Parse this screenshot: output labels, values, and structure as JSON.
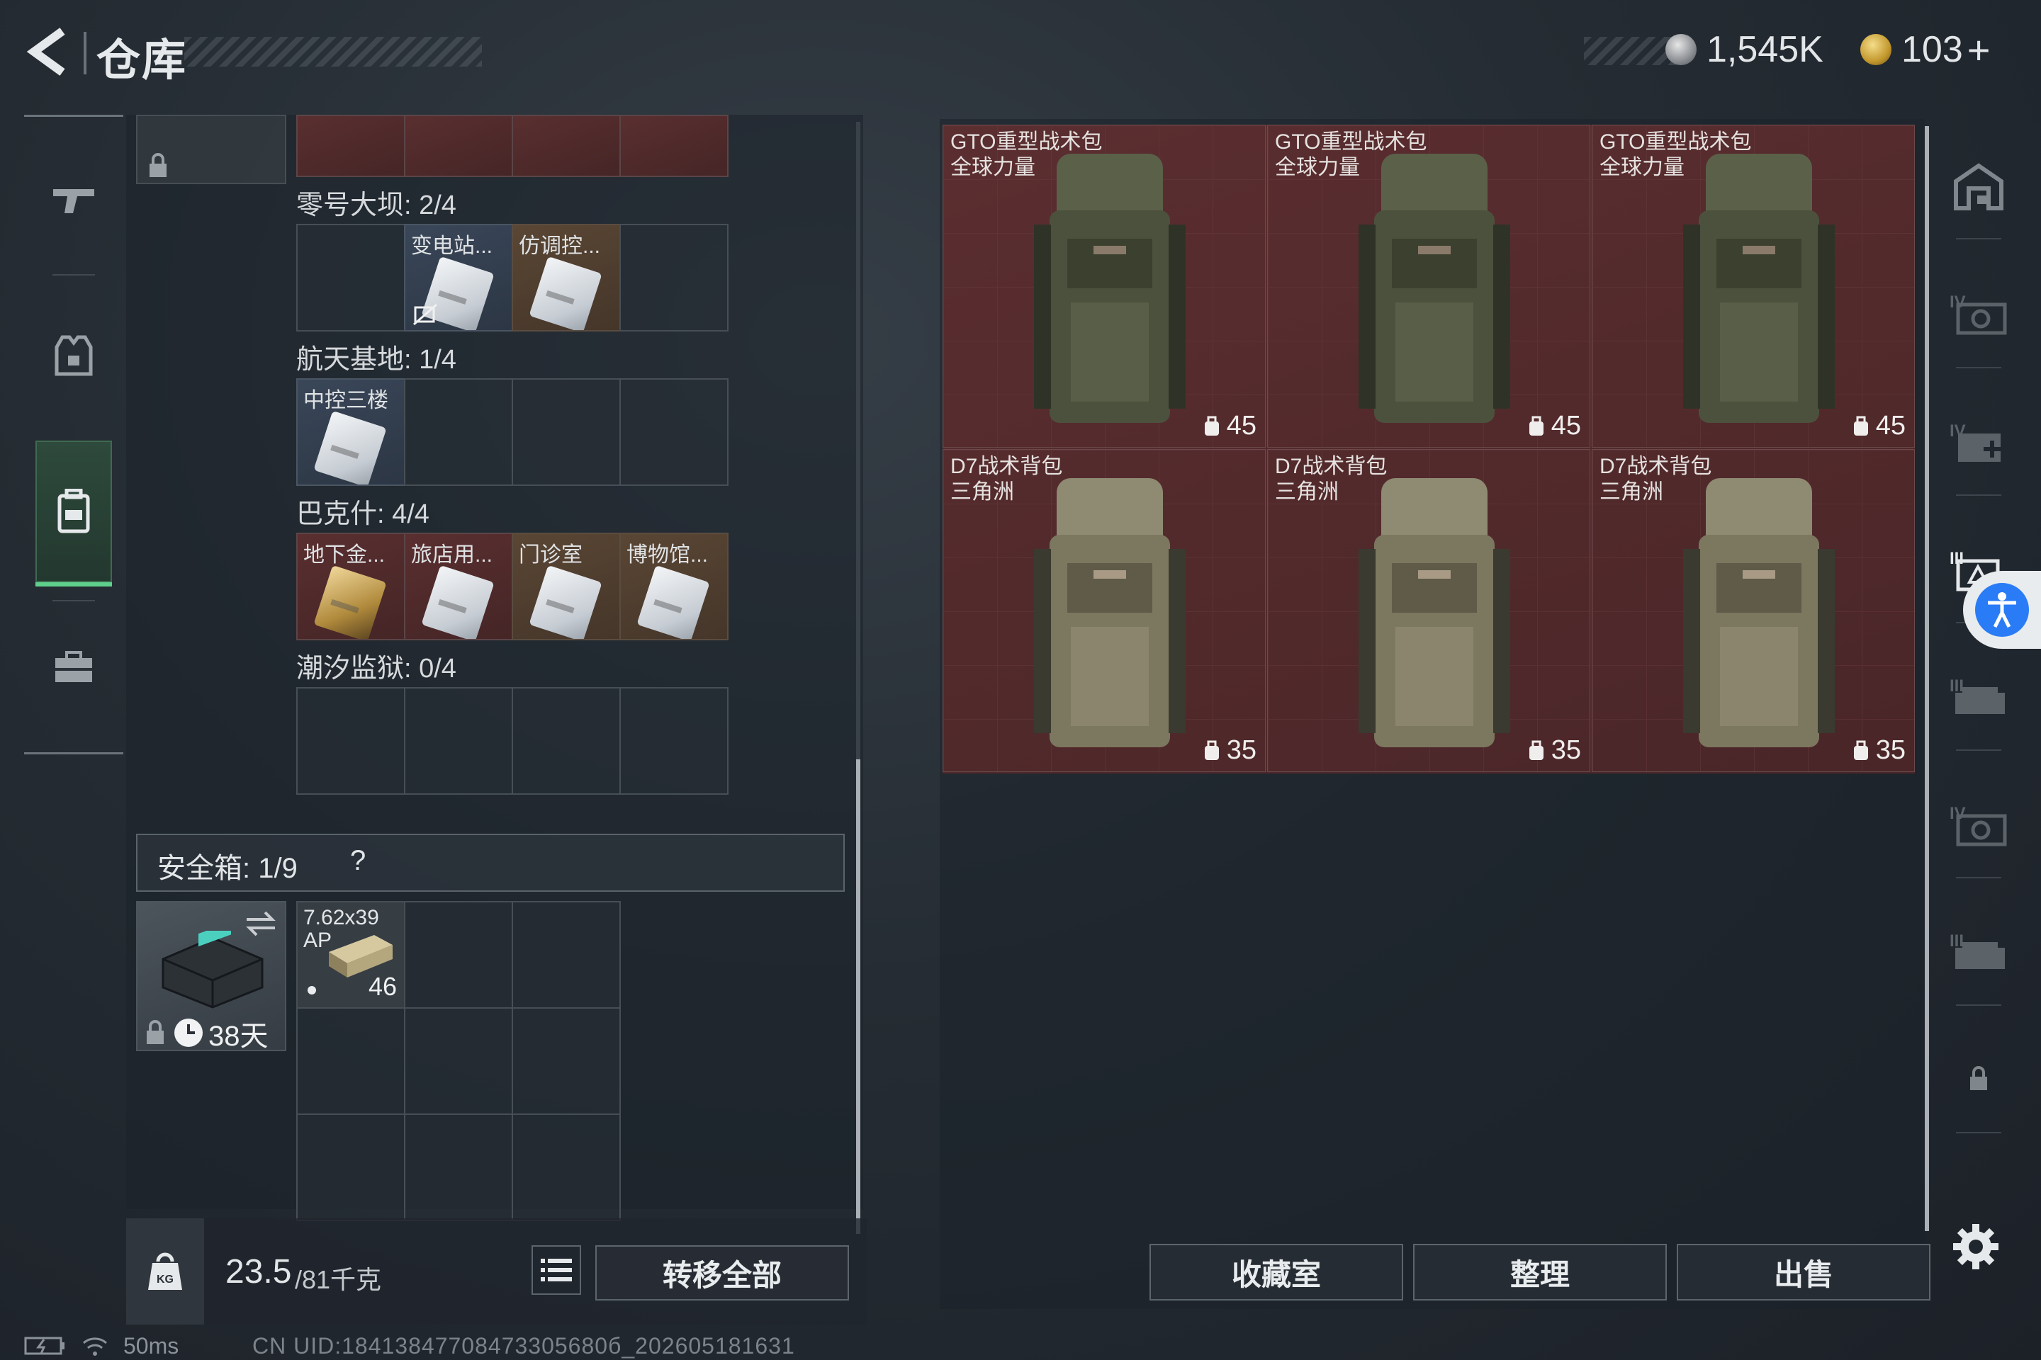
{
  "header": {
    "title": "仓库",
    "currency_silver": "1,545K",
    "currency_gold": "103",
    "currency_plus": "+"
  },
  "stash": {
    "sections": [
      {
        "label": "零号大坝: 2/4",
        "cards": [
          {
            "name": "变电站...",
            "color": "blue",
            "unusable": true
          },
          {
            "name": "仿调控...",
            "color": "gold",
            "unusable": false
          }
        ]
      },
      {
        "label": "航天基地: 1/4",
        "cards": [
          {
            "name": "中控三楼",
            "color": "blue",
            "unusable": false
          }
        ]
      },
      {
        "label": "巴克什: 4/4",
        "cards": [
          {
            "name": "地下金...",
            "color": "red",
            "unusable": false
          },
          {
            "name": "旅店用...",
            "color": "red",
            "unusable": false
          },
          {
            "name": "门诊室",
            "color": "gold",
            "unusable": false
          },
          {
            "name": "博物馆...",
            "color": "gold",
            "unusable": false
          }
        ]
      },
      {
        "label": "潮汐监狱: 0/4",
        "cards": []
      }
    ],
    "safebox_label": "安全箱: 1/9",
    "safebox_help": "?",
    "safebox_days": "38天",
    "ammo_name": "7.62x39 AP",
    "ammo_count": "46",
    "weight_current": "23.5",
    "weight_max": "/81千克",
    "transfer_all": "转移全部"
  },
  "items": [
    {
      "name": "GTO重型战术包",
      "sub": "全球力量",
      "capacity": "45"
    },
    {
      "name": "GTO重型战术包",
      "sub": "全球力量",
      "capacity": "45"
    },
    {
      "name": "GTO重型战术包",
      "sub": "全球力量",
      "capacity": "45"
    },
    {
      "name": "D7战术背包",
      "sub": "三角洲",
      "capacity": "35"
    },
    {
      "name": "D7战术背包",
      "sub": "三角洲",
      "capacity": "35"
    },
    {
      "name": "D7战术背包",
      "sub": "三角洲",
      "capacity": "35"
    }
  ],
  "actions": {
    "collection": "收藏室",
    "sort": "整理",
    "sell": "出售"
  },
  "status": {
    "ping": "50ms",
    "uid": "CN UID:18413847708473305680б_202605181631"
  },
  "colors": {
    "accent_green": "#5fd08c",
    "item_bg_red": "#5b2e30",
    "accessibility_blue": "#2a7cf6"
  }
}
